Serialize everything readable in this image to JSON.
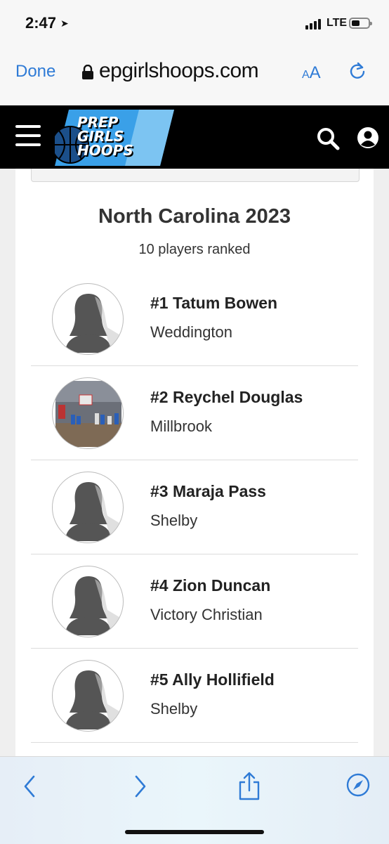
{
  "status": {
    "time": "2:47",
    "network": "LTE"
  },
  "browser": {
    "done_label": "Done",
    "url": "epgirlshoops.com",
    "aa_label": "AA"
  },
  "site": {
    "logo_lines": [
      "PREP",
      "GIRLS",
      "HOOPS"
    ]
  },
  "rankings": {
    "title": "North Carolina 2023",
    "subtitle": "10 players ranked",
    "players": [
      {
        "name": "#1 Tatum Bowen",
        "school": "Weddington",
        "photo": "placeholder"
      },
      {
        "name": "#2 Reychel Douglas",
        "school": "Millbrook",
        "photo": "gym-photo"
      },
      {
        "name": "#3 Maraja Pass",
        "school": "Shelby",
        "photo": "placeholder"
      },
      {
        "name": "#4 Zion Duncan",
        "school": "Victory Christian",
        "photo": "placeholder"
      },
      {
        "name": "#5 Ally Hollifield",
        "school": "Shelby",
        "photo": "placeholder"
      }
    ]
  },
  "colors": {
    "ios_blue": "#2f7bd6",
    "header_bg": "#000000",
    "logo_blue": "#3aa0e8"
  }
}
